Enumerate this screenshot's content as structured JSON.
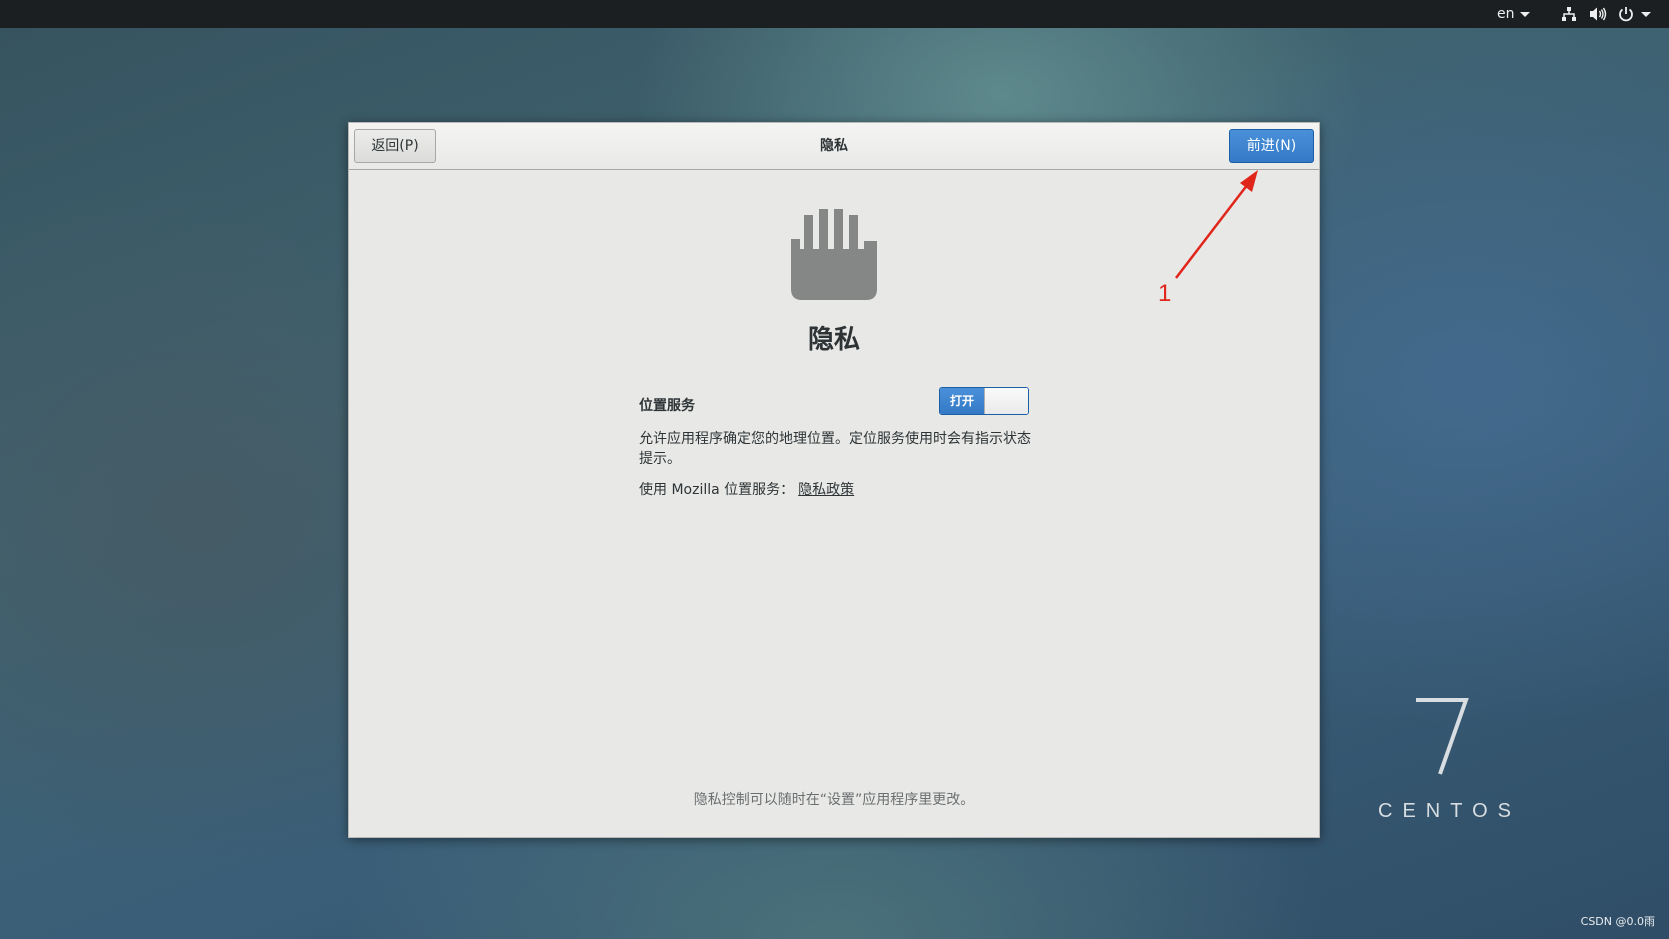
{
  "topbar": {
    "language": "en"
  },
  "dialog": {
    "back_label": "返回(P)",
    "title": "隐私",
    "next_label": "前进(N)",
    "heading": "隐私",
    "location_label": "位置服务",
    "switch_on_label": "打开",
    "description": "允许应用程序确定您的地理位置。定位服务使用时会有指示状态提示。",
    "mozilla_text": "使用 Mozilla 位置服务：",
    "privacy_link": "隐私政策",
    "footer_note": "隐私控制可以随时在“设置”应用程序里更改。"
  },
  "annotation": {
    "number": "1",
    "color": "#e0251b"
  },
  "desktop": {
    "logo_number": "7",
    "logo_text": "CENTOS",
    "watermark": "CSDN @0.0雨"
  },
  "icons": {
    "hand": "hand-stop-icon",
    "network": "network-icon",
    "volume": "volume-icon",
    "power": "power-icon"
  },
  "colors": {
    "accent": "#3a82cf",
    "topbar": "#1b1f22",
    "dialog_bg": "#e8e8e7"
  }
}
